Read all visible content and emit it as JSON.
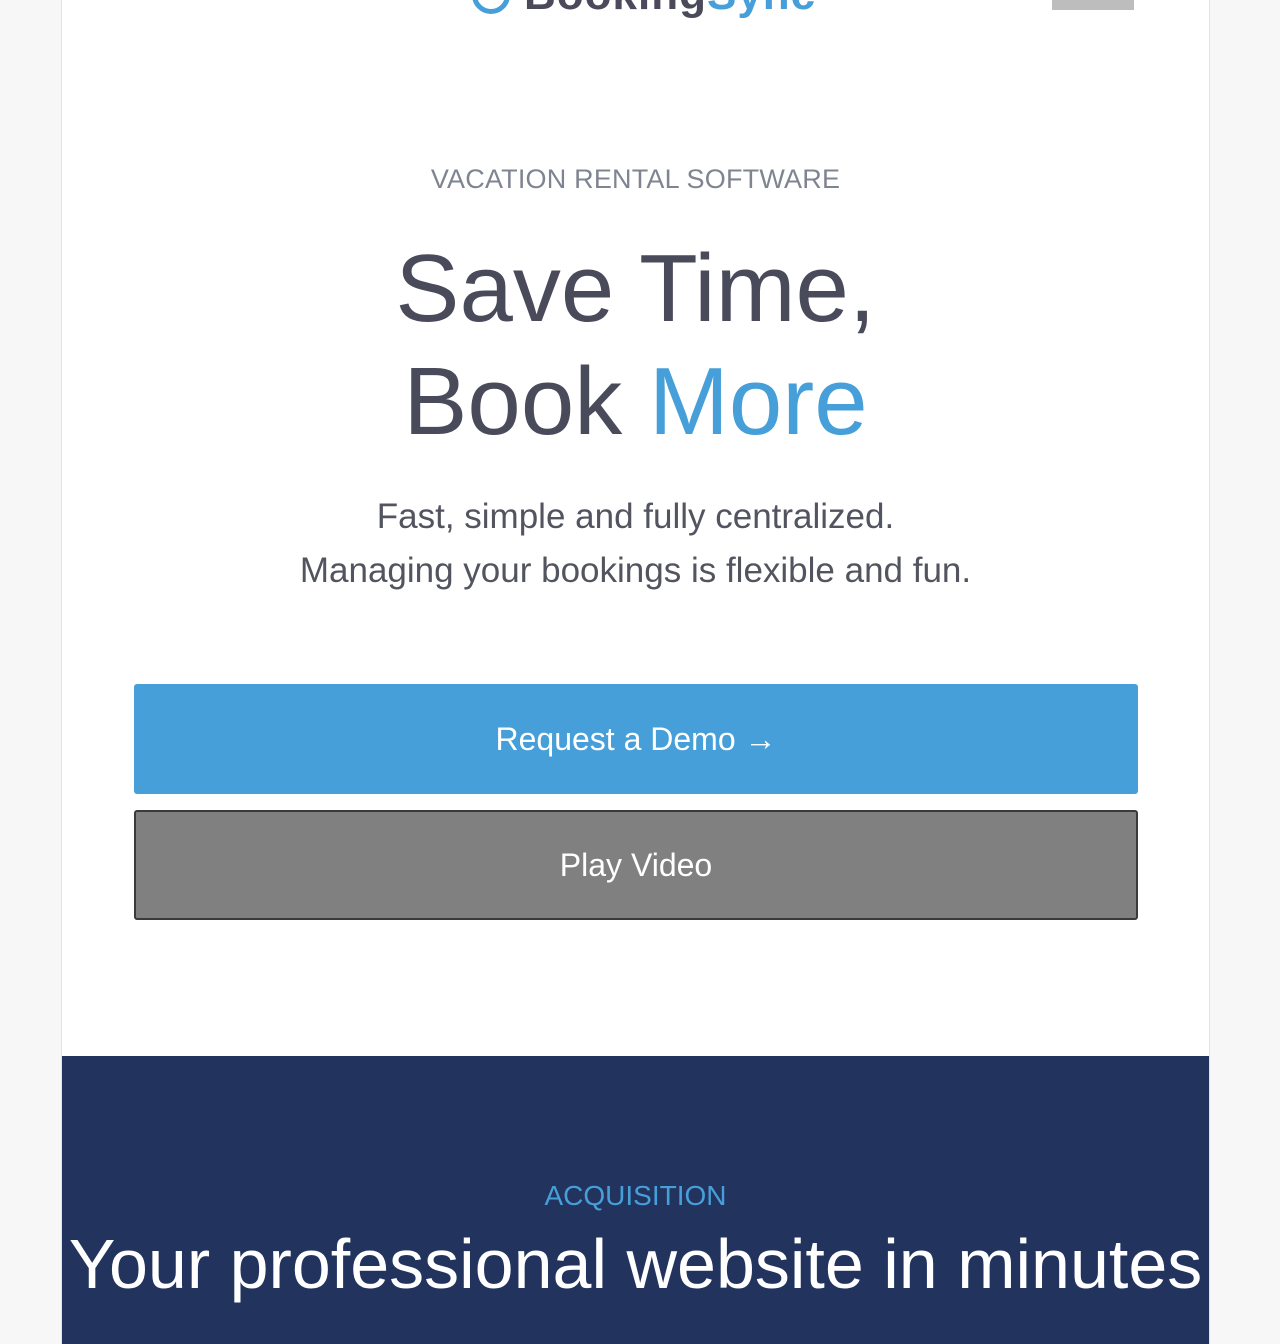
{
  "header": {
    "logo_text_main": "Booking",
    "logo_text_accent": "Sync"
  },
  "hero": {
    "eyebrow": "VACATION RENTAL SOFTWARE",
    "headline_line1": "Save Time,",
    "headline_line2_plain": "Book",
    "headline_line2_accent": "More",
    "sub_line1": "Fast, simple and fully centralized.",
    "sub_line2": "Managing your bookings is flexible and fun.",
    "demo_button": "Request a Demo →",
    "video_button": "Play Video"
  },
  "acquisition": {
    "eyebrow": "ACQUISITION",
    "title": "Your professional website in minutes"
  },
  "colors": {
    "accent": "#469fd8",
    "heading": "#4a4b5a",
    "navy": "#22335e",
    "video_button": "#808080"
  }
}
